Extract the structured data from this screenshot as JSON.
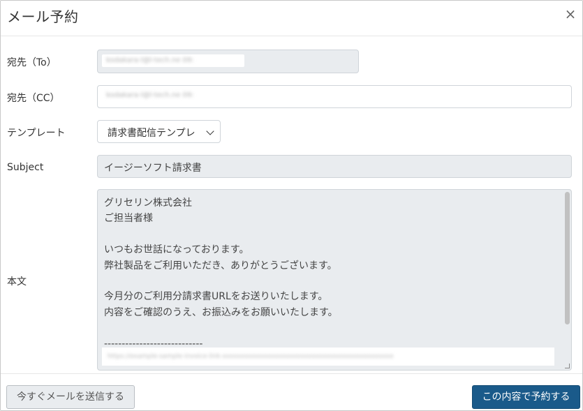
{
  "modal": {
    "title": "メール予約",
    "close_icon": "×"
  },
  "form": {
    "to": {
      "label": "宛先（To）",
      "value": "kodakara-l@l-tech.ne 09:",
      "readonly": true
    },
    "cc": {
      "label": "宛先（CC）",
      "value": "kodakara-l@l-tech.ne 09:"
    },
    "template": {
      "label": "テンプレート",
      "selected": "請求書配信テンプレ"
    },
    "subject": {
      "label": "Subject",
      "value": "イージーソフト請求書",
      "readonly": true
    },
    "body": {
      "label": "本文",
      "lines": [
        "グリセリン株式会社",
        "ご担当者様",
        "",
        "いつもお世話になっております。",
        "弊社製品をご利用いただき、ありがとうございます。",
        "",
        "今月分のご利用分請求書URLをお送りいたします。",
        "内容をご確認のうえ、お振込みをお願いいたします。",
        "",
        "----------------------------"
      ],
      "blurred_url": "https://example-sample-invoice-link-xxxxxxxxxxxxxxxxxxxxxxxxxxxxxxxxxxxxxxxxxxxxxx"
    }
  },
  "footer": {
    "send_now_label": "今すぐメールを送信する",
    "reserve_label": "この内容で予約する"
  },
  "colors": {
    "primary": "#1a5a8a",
    "readonly_bg": "#e9ecef",
    "border": "#cfd4d9"
  }
}
